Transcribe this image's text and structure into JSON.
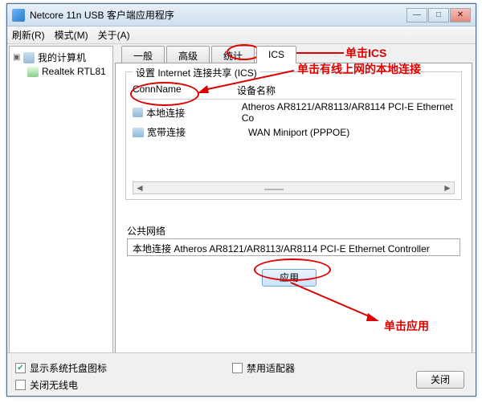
{
  "window": {
    "title": "Netcore 11n USB 客户端应用程序"
  },
  "menu": {
    "refresh": "刷新(R)",
    "mode": "模式(M)",
    "about": "关于(A)"
  },
  "tree": {
    "root": "我的计算机",
    "child": "Realtek RTL81"
  },
  "tabs": {
    "general": "一般",
    "advanced": "高级",
    "stats": "统计",
    "ics": "ICS"
  },
  "group": {
    "title": "设置 Internet 连接共享 (ICS)",
    "col_conn": "ConnName",
    "col_device": "设备名称",
    "rows": [
      {
        "name": "本地连接",
        "device": "Atheros AR8121/AR8113/AR8114 PCI-E Ethernet Co"
      },
      {
        "name": "宽带连接",
        "device": "WAN Miniport (PPPOE)"
      }
    ]
  },
  "public": {
    "label": "公共网络",
    "value": "本地连接 Atheros AR8121/AR8113/AR8114 PCI-E Ethernet Controller"
  },
  "buttons": {
    "apply": "应用",
    "close": "关闭"
  },
  "bottom": {
    "tray": "显示系统托盘图标",
    "wifi_off": "关闭无线电",
    "disable_adapter": "禁用适配器"
  },
  "anno": {
    "click_ics": "单击ICS",
    "click_local": "单击有线上网的本地连接",
    "click_apply": "单击应用"
  },
  "win_controls": {
    "min": "—",
    "max": "□",
    "close": "✕"
  }
}
